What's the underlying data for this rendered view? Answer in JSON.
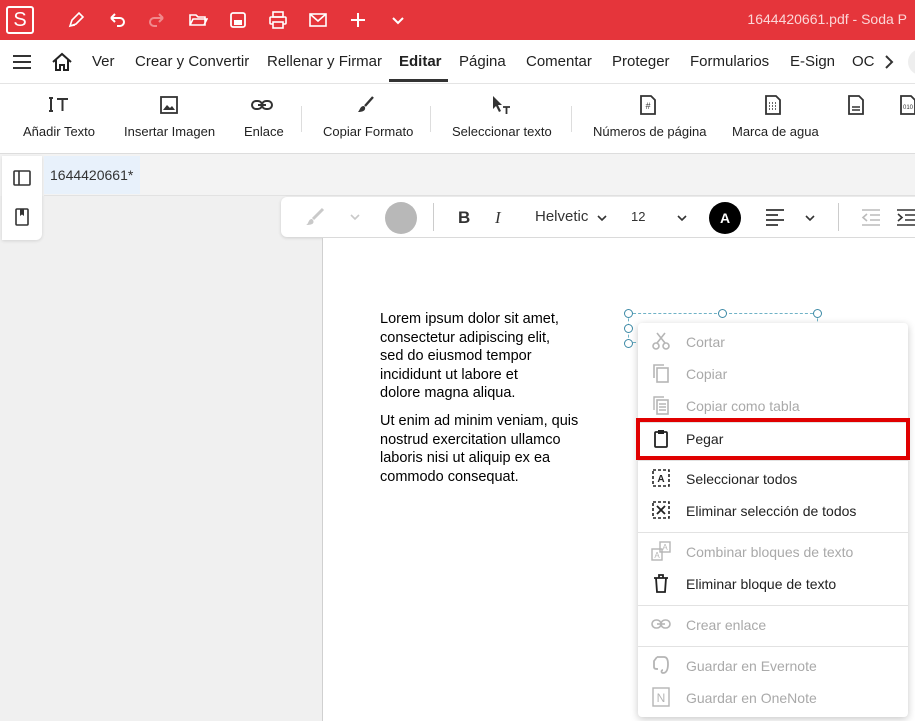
{
  "titlebar": {
    "logo": "S",
    "title": "1644420661.pdf  -  Soda P",
    "quick_icons": [
      "pen-icon",
      "undo-icon",
      "redo-icon",
      "open-folder-icon",
      "save-icon",
      "print-icon",
      "mail-icon",
      "plus-icon",
      "chevron-down-icon"
    ],
    "accent": "#e5353b"
  },
  "menubar": {
    "items": [
      "Ver",
      "Crear y Convertir",
      "Rellenar y Firmar",
      "Editar",
      "Página",
      "Comentar",
      "Proteger",
      "Formularios",
      "E-Sign",
      "OC"
    ],
    "active": "Editar"
  },
  "toolbar": {
    "tools": [
      {
        "label": "Añadir Texto",
        "icon": "add-text-icon"
      },
      {
        "label": "Insertar Imagen",
        "icon": "image-icon"
      },
      {
        "label": "Enlace",
        "icon": "link-icon"
      },
      {
        "label": "Copiar Formato",
        "icon": "brush-icon"
      },
      {
        "label": "Seleccionar texto",
        "icon": "select-text-icon"
      },
      {
        "label": "Números de página",
        "icon": "page-number-icon"
      },
      {
        "label": "Marca de agua",
        "icon": "watermark-icon"
      }
    ]
  },
  "doc_tab": {
    "label": "1644420661*"
  },
  "format_bar": {
    "font": "Helvetic",
    "size": "12",
    "color_label": "A"
  },
  "document": {
    "para1": [
      "Lorem ipsum dolor sit amet,",
      "consectetur adipiscing elit,",
      "sed do eiusmod tempor",
      "incididunt ut labore et",
      "dolore magna aliqua."
    ],
    "para2": [
      "Ut enim ad minim veniam, quis",
      "nostrud exercitation ullamco",
      "laboris nisi ut aliquip ex ea",
      "commodo consequat."
    ]
  },
  "context_menu": {
    "items": [
      {
        "label": "Cortar",
        "icon": "scissors-icon",
        "enabled": false
      },
      {
        "label": "Copiar",
        "icon": "copy-icon",
        "enabled": false
      },
      {
        "label": "Copiar como tabla",
        "icon": "copy-table-icon",
        "enabled": false
      },
      {
        "label": "Pegar",
        "icon": "clipboard-icon",
        "enabled": true,
        "highlighted": true
      },
      {
        "label": "Seleccionar todos",
        "icon": "select-all-icon",
        "enabled": true
      },
      {
        "label": "Eliminar selección de todos",
        "icon": "deselect-all-icon",
        "enabled": true
      },
      {
        "label": "Combinar bloques de texto",
        "icon": "combine-text-icon",
        "enabled": false
      },
      {
        "label": "Eliminar bloque de texto",
        "icon": "trash-icon",
        "enabled": true
      },
      {
        "label": "Crear enlace",
        "icon": "link-icon",
        "enabled": false
      },
      {
        "label": "Guardar en Evernote",
        "icon": "evernote-icon",
        "enabled": false
      },
      {
        "label": "Guardar en OneNote",
        "icon": "onenote-icon",
        "enabled": false
      }
    ],
    "highlight_color": "#e00000"
  }
}
